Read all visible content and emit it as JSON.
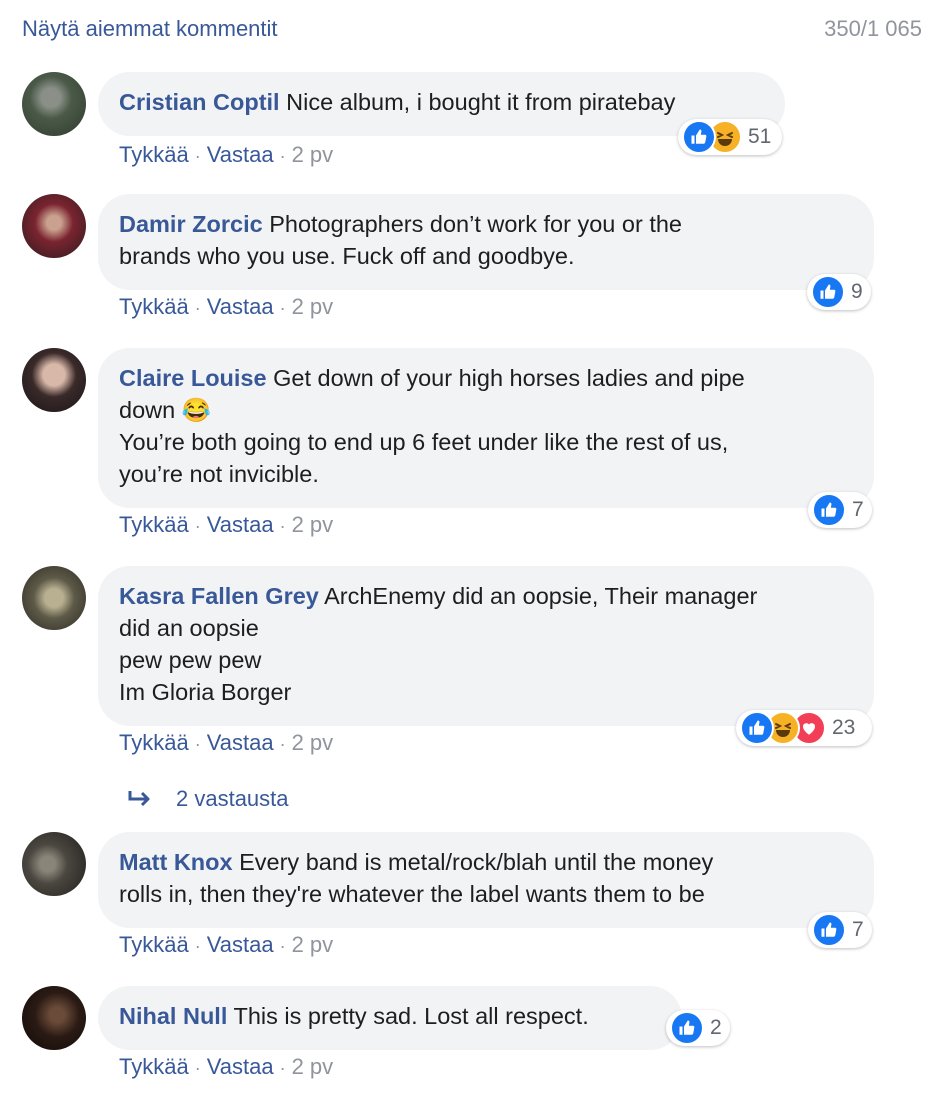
{
  "header": {
    "prev_link": "Näytä aiemmat kommentit",
    "counter": "350/1 065"
  },
  "labels": {
    "like": "Tykkää",
    "reply": "Vastaa",
    "sep": "·"
  },
  "colors": {
    "link": "#385898",
    "bubble": "#f2f3f5",
    "meta": "#90949c",
    "like": "#1877f2",
    "haha": "#f7b125",
    "love": "#f33e58"
  },
  "comments": [
    {
      "author": "Cristian Coptil",
      "lines": [
        "Nice album, i bought it from piratebay"
      ],
      "time": "2 pv",
      "reactions": [
        "like",
        "haha"
      ],
      "count": "51"
    },
    {
      "author": "Damir Zorcic",
      "lines": [
        "Photographers don’t work for you or the",
        "brands who you use. Fuck off and goodbye."
      ],
      "time": "2 pv",
      "reactions": [
        "like"
      ],
      "count": "9"
    },
    {
      "author": "Claire Louise",
      "lines": [
        "Get down of your high horses ladies and pipe",
        "down 😂",
        "You’re both going to end up 6 feet under like the rest of us,",
        "you’re not invicible."
      ],
      "time": "2 pv",
      "reactions": [
        "like"
      ],
      "count": "7"
    },
    {
      "author": "Kasra Fallen Grey",
      "lines": [
        "ArchEnemy did an oopsie, Their manager",
        "did an oopsie",
        "pew pew pew",
        "Im Gloria Borger"
      ],
      "time": "2 pv",
      "reactions": [
        "like",
        "haha",
        "love"
      ],
      "count": "23"
    },
    {
      "author": "Matt Knox",
      "lines": [
        "Every band is metal/rock/blah until the money",
        "rolls in, then they're whatever the label wants them to be"
      ],
      "time": "2 pv",
      "reactions": [
        "like"
      ],
      "count": "7"
    },
    {
      "author": "Nihal Null",
      "lines": [
        "This is pretty sad. Lost all respect."
      ],
      "time": "2 pv",
      "reactions": [
        "like"
      ],
      "count": "2"
    }
  ],
  "replies_link": "2 vastausta",
  "icons": {
    "like": "thumbs-up-icon",
    "haha": "laughing-face-icon",
    "love": "heart-icon",
    "reply_arrow": "reply-arrow-icon"
  }
}
